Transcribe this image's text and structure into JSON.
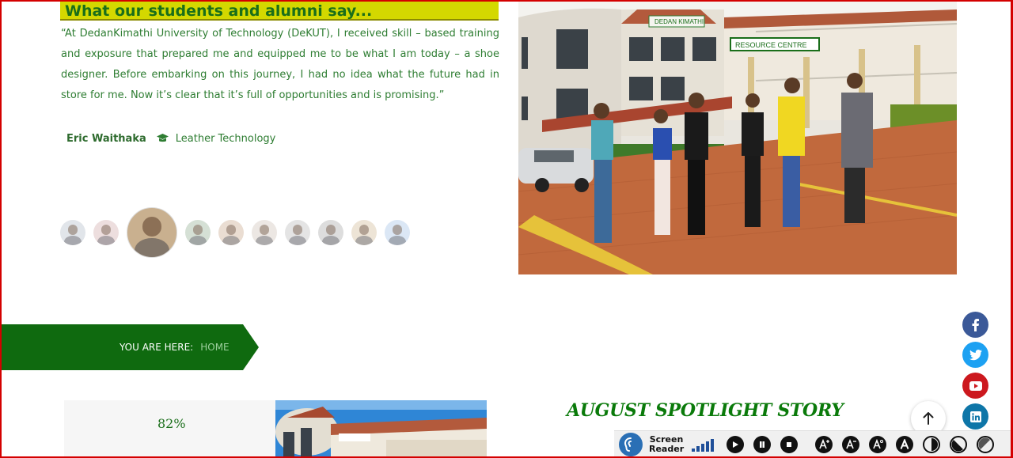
{
  "testimonial": {
    "heading": "What our students and alumni say...",
    "quote": " “At DedanKimathi University of Technology (DeKUT), I received skill – based training and exposure that prepared me and equipped me to be what I am today – a      shoe designer. Before embarking on this journey, I had no idea what the future had in store for me. Now it’s clear that it’s full of opportunities and is promising.”",
    "author": "Eric Waithaka",
    "course": "Leather Technology"
  },
  "photo": {
    "building_sign": "DEDAN KIMATHI",
    "resource_sign": "RESOURCE CENTRE"
  },
  "breadcrumb": {
    "label": "YOU ARE HERE:",
    "home": "HOME"
  },
  "progress": {
    "percent_text": "82%",
    "value": 0.82
  },
  "spotlight": {
    "title": "AUGUST SPOTLIGHT STORY"
  },
  "social": [
    {
      "name": "facebook",
      "color": "#3b5998"
    },
    {
      "name": "twitter",
      "color": "#1da1f2"
    },
    {
      "name": "youtube",
      "color": "#cc181e"
    },
    {
      "name": "linkedin",
      "color": "#0e76a8"
    }
  ],
  "accessibility": {
    "screen_reader_label_1": "Screen",
    "screen_reader_label_2": "Reader",
    "accent": "#1f4f99"
  },
  "colors": {
    "brand_green": "#0f6a0f",
    "heading_yellow": "#d4d800",
    "text_green": "#2e7d32"
  }
}
